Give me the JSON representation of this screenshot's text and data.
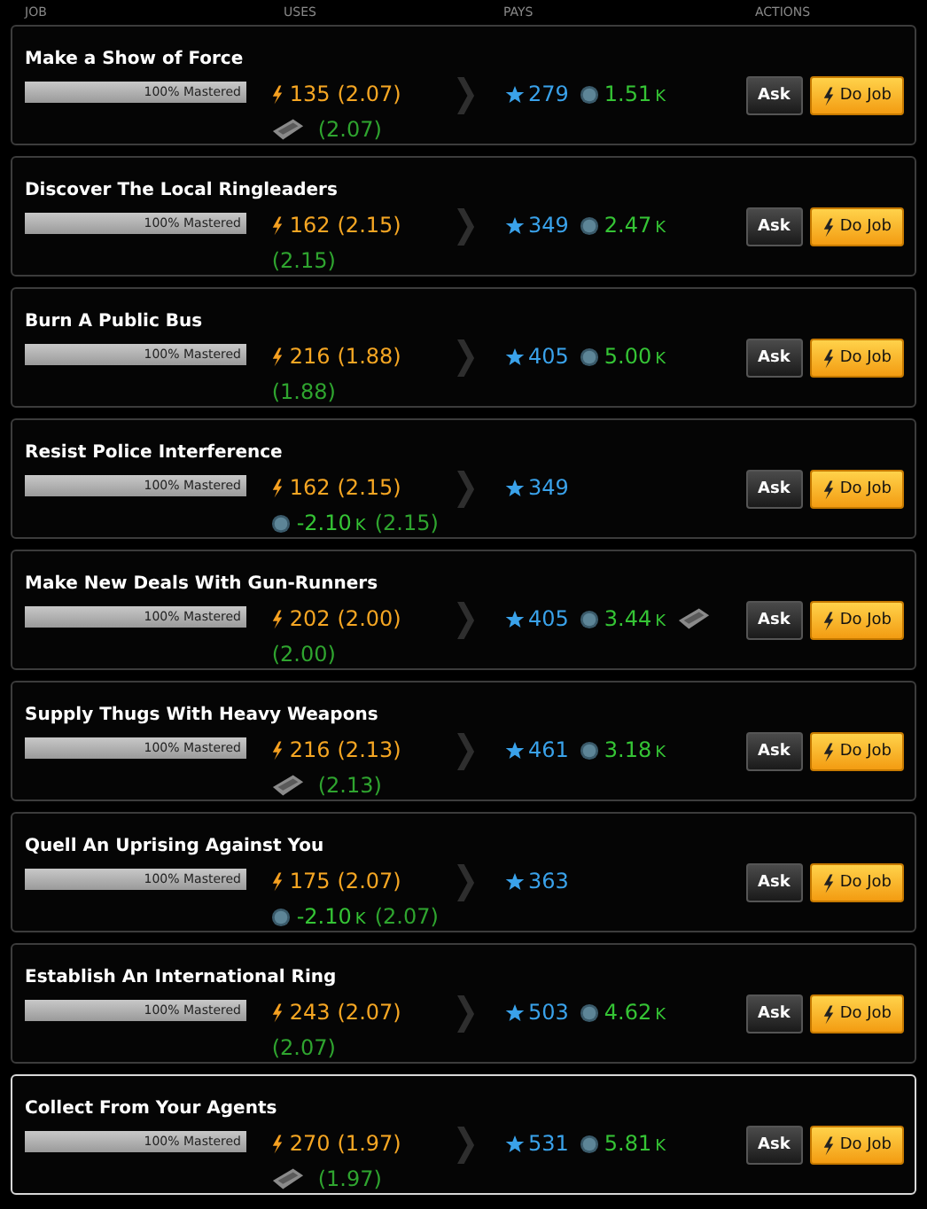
{
  "columns": [
    "JOB",
    "USES",
    "PAYS",
    "ACTIONS"
  ],
  "jobs": [
    {
      "title": "Make a Show of Force",
      "mastery": {
        "label": "100% Mastered",
        "level": 1
      },
      "energy": "135",
      "energy_ratio": "(2.07)",
      "cost": {
        "kind": "item"
      },
      "cost_ratio": "(2.07)",
      "xp": "279",
      "pay_money": "1.51",
      "pay_unit": "K",
      "loot": false,
      "selected": false,
      "ask": "Ask",
      "do": "Do Job"
    },
    {
      "title": "Discover The Local Ringleaders",
      "mastery": {
        "label": "100% Mastered",
        "level": 1
      },
      "energy": "162",
      "energy_ratio": "(2.15)",
      "cost": {
        "kind": "none"
      },
      "cost_ratio": "(2.15)",
      "xp": "349",
      "pay_money": "2.47",
      "pay_unit": "K",
      "loot": false,
      "selected": false,
      "ask": "Ask",
      "do": "Do Job"
    },
    {
      "title": "Burn A Public Bus",
      "mastery": {
        "label": "100% Mastered",
        "level": 1
      },
      "energy": "216",
      "energy_ratio": "(1.88)",
      "cost": {
        "kind": "none"
      },
      "cost_ratio": "(1.88)",
      "xp": "405",
      "pay_money": "5.00",
      "pay_unit": "K",
      "loot": false,
      "selected": false,
      "ask": "Ask",
      "do": "Do Job"
    },
    {
      "title": "Resist Police Interference",
      "mastery": {
        "label": "100% Mastered",
        "level": 1
      },
      "energy": "162",
      "energy_ratio": "(2.15)",
      "cost": {
        "kind": "money",
        "amount": "-2.10",
        "unit": "K"
      },
      "cost_ratio": "(2.15)",
      "xp": "349",
      "loot": false,
      "selected": false,
      "ask": "Ask",
      "do": "Do Job"
    },
    {
      "title": "Make New Deals With Gun-Runners",
      "mastery": {
        "label": "100% Mastered",
        "level": 1
      },
      "energy": "202",
      "energy_ratio": "(2.00)",
      "cost": {
        "kind": "none"
      },
      "cost_ratio": "(2.00)",
      "xp": "405",
      "pay_money": "3.44",
      "pay_unit": "K",
      "loot": true,
      "selected": false,
      "ask": "Ask",
      "do": "Do Job"
    },
    {
      "title": "Supply Thugs With Heavy Weapons",
      "mastery": {
        "label": "100% Mastered",
        "level": 1
      },
      "energy": "216",
      "energy_ratio": "(2.13)",
      "cost": {
        "kind": "item"
      },
      "cost_ratio": "(2.13)",
      "xp": "461",
      "pay_money": "3.18",
      "pay_unit": "K",
      "loot": false,
      "selected": false,
      "ask": "Ask",
      "do": "Do Job"
    },
    {
      "title": "Quell An Uprising Against You",
      "mastery": {
        "label": "100% Mastered",
        "level": 1
      },
      "energy": "175",
      "energy_ratio": "(2.07)",
      "cost": {
        "kind": "money",
        "amount": "-2.10",
        "unit": "K"
      },
      "cost_ratio": "(2.07)",
      "xp": "363",
      "loot": false,
      "selected": false,
      "ask": "Ask",
      "do": "Do Job"
    },
    {
      "title": "Establish An International Ring",
      "mastery": {
        "label": "100% Mastered",
        "level": 1
      },
      "energy": "243",
      "energy_ratio": "(2.07)",
      "cost": {
        "kind": "none"
      },
      "cost_ratio": "(2.07)",
      "xp": "503",
      "pay_money": "4.62",
      "pay_unit": "K",
      "loot": false,
      "selected": false,
      "ask": "Ask",
      "do": "Do Job"
    },
    {
      "title": "Collect From Your Agents",
      "mastery": {
        "label": "100% Mastered",
        "level": 1
      },
      "energy": "270",
      "energy_ratio": "(1.97)",
      "cost": {
        "kind": "item"
      },
      "cost_ratio": "(1.97)",
      "xp": "531",
      "pay_money": "5.81",
      "pay_unit": "K",
      "loot": false,
      "selected": true,
      "ask": "Ask",
      "do": "Do Job"
    }
  ]
}
